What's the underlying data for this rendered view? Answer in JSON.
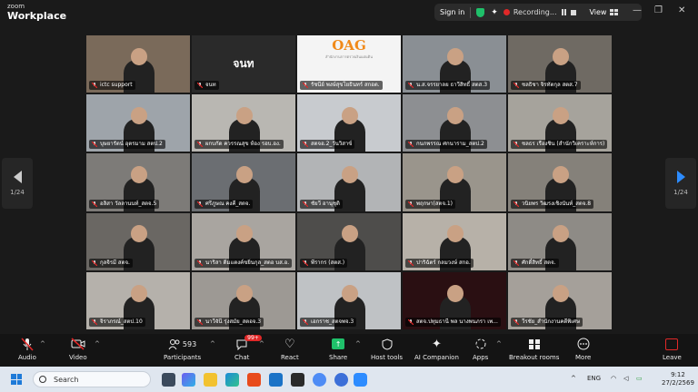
{
  "app": {
    "brand_small": "zoom",
    "brand_name": "Workplace"
  },
  "meeting_bar": {
    "sign_in": "Sign in",
    "recording_label": "Recording...",
    "view_label": "View"
  },
  "paging": {
    "left_page": "1/24",
    "right_page": "1/24"
  },
  "participants": [
    {
      "name": "ictc support",
      "active": true,
      "bg": "#7a6a5a"
    },
    {
      "name": "จนท",
      "center_text": "จนท",
      "bg": "#2a2a2a",
      "no_video": true
    },
    {
      "name": "รัชนีย์ พงษ์สุขโยธินทร์ สกอต.",
      "bg": "#f4f4f4",
      "logo": "OAG",
      "logo_sub": "สำนักงานการตรวจเงินแผ่นดิน"
    },
    {
      "name": "น.ส.จรรยาลย ธาวีสิทธิ์ สตส.3",
      "bg": "#8a8f94"
    },
    {
      "name": "ชลธิชา จิรทัตกุล สตส.7",
      "bg": "#6f6a63"
    },
    {
      "name": "บุษยารัตน์ อุตรมาม สตป.2",
      "bg": "#9ea4aa"
    },
    {
      "name": "ผกบกัด ควรรณสุข ห้อง รอบ.อง.",
      "bg": "#b9b7b2"
    },
    {
      "name": "สตจอ.2_วันวิสาข์",
      "bg": "#c8cbcf"
    },
    {
      "name": "กนกพรรณ ศกนาราม_สตป.2",
      "bg": "#8d8f92"
    },
    {
      "name": "ชลธร เรืองชิน (สำนักวิเคราะห์การ)",
      "bg": "#a6a39c"
    },
    {
      "name": "อลิสา วัลลานนท์_สตจ.5",
      "bg": "#7d7b78"
    },
    {
      "name": "ศรีภูษณ คงคี_สตจ.",
      "bg": "#6b6e72"
    },
    {
      "name": "ชัยวี อานุชุติ",
      "bg": "#b2b4b6"
    },
    {
      "name": "พฤกษา(สตจ.1)",
      "bg": "#9a958c"
    },
    {
      "name": "วนิยพร วิฒรงเชิงนันท์_สตจ.8",
      "bg": "#85817a"
    },
    {
      "name": "กุลจิรมี สตจ.",
      "bg": "#6a6763"
    },
    {
      "name": "นาริสา ดิ่มแตงค์ขยิ่นกุล_สตอ บส.อ.",
      "bg": "#a9a5a0"
    },
    {
      "name": "พีรากร (สตส.)",
      "bg": "#4e4d4b"
    },
    {
      "name": "ปาริฉัตร์ กลมวงษ์ สกอ.",
      "bg": "#b7b1a8"
    },
    {
      "name": "ศักดิ์สิทธิ์ สตจ.",
      "bg": "#8e8b86"
    },
    {
      "name": "จิราภรณ์_สตป.10",
      "bg": "#b5b1ab"
    },
    {
      "name": "นาวีจันี รุ่งสมัย_สตอจ.3",
      "bg": "#9d9994"
    },
    {
      "name": "เอกราช_สตจพจ.3",
      "bg": "#bfc2c5"
    },
    {
      "name": "สตจ.ปทุมธานี พล นางพนภรา เพ...",
      "bg": "#2a0f12"
    },
    {
      "name": "วีรชัย_สำนักงานคดีพิเศษ",
      "bg": "#a5a09a"
    }
  ],
  "toolbar": {
    "audio": "Audio",
    "video": "Video",
    "participants": "Participants",
    "participants_count": "593",
    "chat": "Chat",
    "chat_badge": "99+",
    "react": "React",
    "share": "Share",
    "host_tools": "Host tools",
    "ai_companion": "AI Companion",
    "apps": "Apps",
    "breakout_rooms": "Breakout rooms",
    "more": "More",
    "leave": "Leave"
  },
  "taskbar": {
    "search_placeholder": "Search",
    "language": "ENG",
    "time": "9:12",
    "date": "27/2/2569"
  },
  "colors": {
    "accent": "#2d8cff",
    "active_speaker": "#2fc24a",
    "record": "#e02828",
    "leave": "#e02828"
  }
}
